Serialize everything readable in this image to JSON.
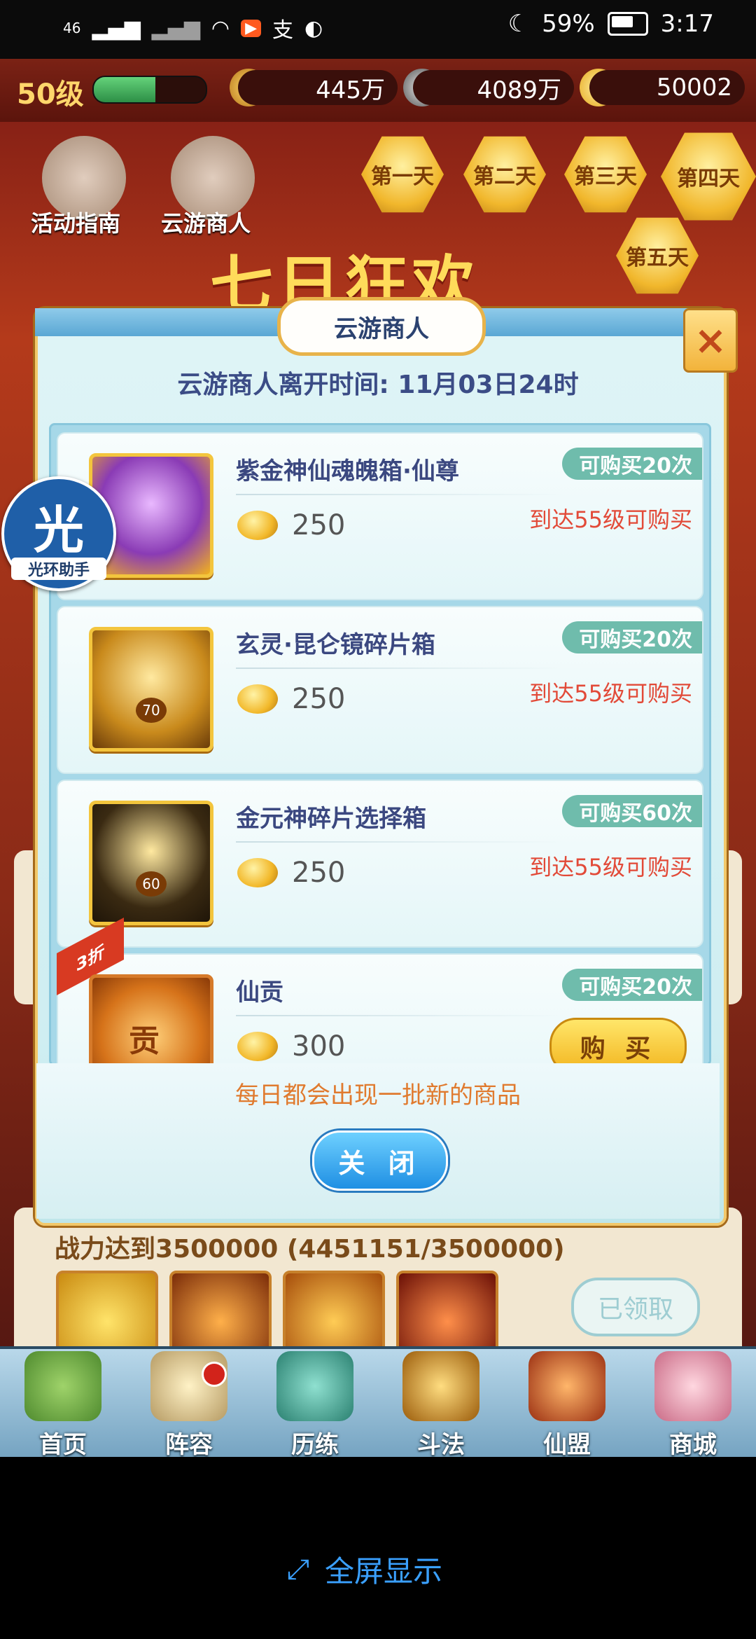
{
  "status_bar": {
    "network": "46",
    "battery": "59%",
    "battery_level": 0.59,
    "time": "3:17"
  },
  "game": {
    "level_label": "50级",
    "level_progress": 0.55,
    "power": "445万",
    "copper": "4089万",
    "gold": "50002",
    "shortcut_1": "活动指南",
    "shortcut_2": "云游商人",
    "banner": "七日狂欢",
    "days": [
      "第一天",
      "第二天",
      "第三天",
      "第四天",
      "第五天"
    ],
    "bg_task": "战力达到3500000 (4451151/3500000)",
    "bg_claimed": "已领取",
    "nav": [
      "首页",
      "阵容",
      "历练",
      "斗法",
      "仙盟",
      "商城"
    ]
  },
  "helper": {
    "glyph": "光",
    "label": "光环助手"
  },
  "modal": {
    "title": "云游商人",
    "leave_time": "云游商人离开时间: 11月03日24时",
    "items": [
      {
        "name": "紫金神仙魂魄箱·仙尊",
        "price": "250",
        "limit": "可购买20次",
        "requirement": "到达55级可购买"
      },
      {
        "name": "玄灵·昆仑镜碎片箱",
        "price": "250",
        "limit": "可购买20次",
        "requirement": "到达55级可购买",
        "pic_label": "70"
      },
      {
        "name": "金元神碎片选择箱",
        "price": "250",
        "limit": "可购买60次",
        "requirement": "到达55级可购买",
        "pic_label": "60"
      },
      {
        "name": "仙贡",
        "price": "300",
        "limit": "可购买20次",
        "buy": "购 买",
        "discount": "3折",
        "pic_label": "贡"
      }
    ],
    "daily_note": "每日都会出现一批新的商品",
    "close_label": "关 闭"
  },
  "footer": {
    "fullscreen": "全屏显示"
  }
}
